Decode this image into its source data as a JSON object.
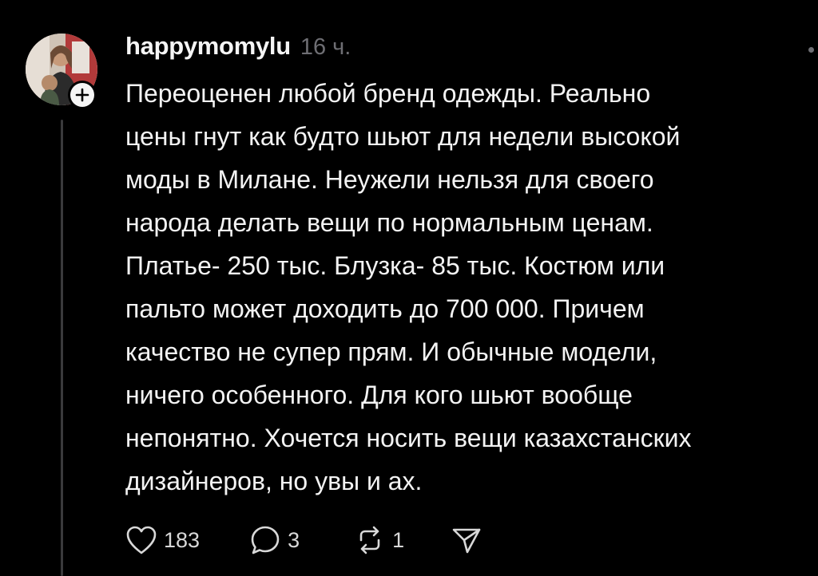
{
  "post": {
    "username": "happymomylu",
    "time": "16 ч.",
    "text_lines": [
      "Переоценен любой бренд одежды. Реально",
      "цены гнут как будто шьют для недели высокой",
      "моды в Милане. Неужели нельзя для своего",
      "народа делать вещи по нормальным ценам.",
      "Платье- 250 тыс. Блузка- 85 тыс. Костюм или",
      "пальто может доходить до 700 000. Причем",
      "качество не супер прям. И обычные модели,",
      "ничего особенного. Для кого шьют вообще",
      "непонятно. Хочется носить вещи казахстанских",
      "дизайнеров, но увы и ах."
    ],
    "actions": {
      "likes": "183",
      "replies": "3",
      "reposts": "1"
    }
  },
  "icons": {
    "like": "heart-icon",
    "reply": "speech-bubble-icon",
    "repost": "repost-icon",
    "share": "send-icon",
    "follow": "plus-icon",
    "menu": "more-dots-icon"
  },
  "colors": {
    "background": "#000000",
    "primary_text": "#f3f3f3",
    "secondary_text": "#6e6e73",
    "thread_line": "#3a3a3c"
  }
}
